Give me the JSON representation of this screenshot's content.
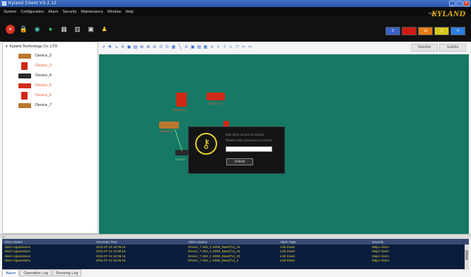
{
  "window": {
    "title": "Kyland Client V3.2.12"
  },
  "menu": [
    "System",
    "Configuration",
    "Alarm",
    "Security",
    "Maintenance",
    "Window",
    "Help"
  ],
  "brand": {
    "name": "KYLAND",
    "small": "Kyland"
  },
  "alarm_indicators": [
    {
      "value": "3",
      "color": "#3a63c7"
    },
    {
      "value": "",
      "color": "#d11a12"
    },
    {
      "value": "13",
      "color": "#e57b14"
    },
    {
      "value": "0",
      "color": "#d6c81a"
    },
    {
      "value": "0",
      "color": "#2d7fe0"
    }
  ],
  "tree": {
    "root": "Kyland Technology Co.,LTD",
    "items": [
      {
        "label": "Device_2",
        "alarm": false,
        "kind": "tan"
      },
      {
        "label": "Device_3",
        "alarm": true,
        "kind": "tall"
      },
      {
        "label": "Device_4",
        "alarm": false,
        "kind": "dark"
      },
      {
        "label": "Device_5",
        "alarm": true,
        "kind": "red"
      },
      {
        "label": "Device_6",
        "alarm": true,
        "kind": "tall"
      },
      {
        "label": "Device_7",
        "alarm": false,
        "kind": "tan"
      }
    ]
  },
  "canvas_tabs": [
    "MainNet",
    "SubNet"
  ],
  "canvas_nodes": {
    "device3": "Device_3",
    "device5": "Device_5",
    "device6": "Device_6",
    "device4": "Device"
  },
  "lock_dialog": {
    "message1": "Edit client access is locked.",
    "message2": "Please enter password to unlock",
    "password_value": "",
    "unlock_label": "Unlock"
  },
  "alarm_table": {
    "headers": [
      "Alarm Status",
      "Generate Time",
      "Alarm Source",
      "Alarm Type",
      "Severity"
    ],
    "rows": [
      [
        "Alarm Appearance",
        "2011-07-13 16:36:15",
        "Device_7 Slot_2 100M_Base(Tx)_24",
        "Link Down",
        "Major Alarm"
      ],
      [
        "Alarm Appearance",
        "2011-07-13 16:36:15",
        "Device_7 Slot_2 100M_Base(Tx)_22",
        "Link Down",
        "Major Alarm"
      ],
      [
        "Alarm Appearance",
        "2011-07-13 16:36:15",
        "Device_7 Slot_1 100M_Base(Tx)_43",
        "Link Down",
        "Major Alarm"
      ],
      [
        "Alarm Appearance",
        "2011-07-13 16:36:15",
        "Device_7 Slot_1 100M_Base(Tx)_3",
        "Link Down",
        "Major Alarm"
      ]
    ]
  },
  "bottom_tabs": [
    "Alarm",
    "Operation Log",
    "Running Log"
  ],
  "icons": [
    "power-icon",
    "lock-icon",
    "topology-icon",
    "alarm-icon",
    "device-icon",
    "performance-icon",
    "security-icon",
    "user-icon"
  ]
}
